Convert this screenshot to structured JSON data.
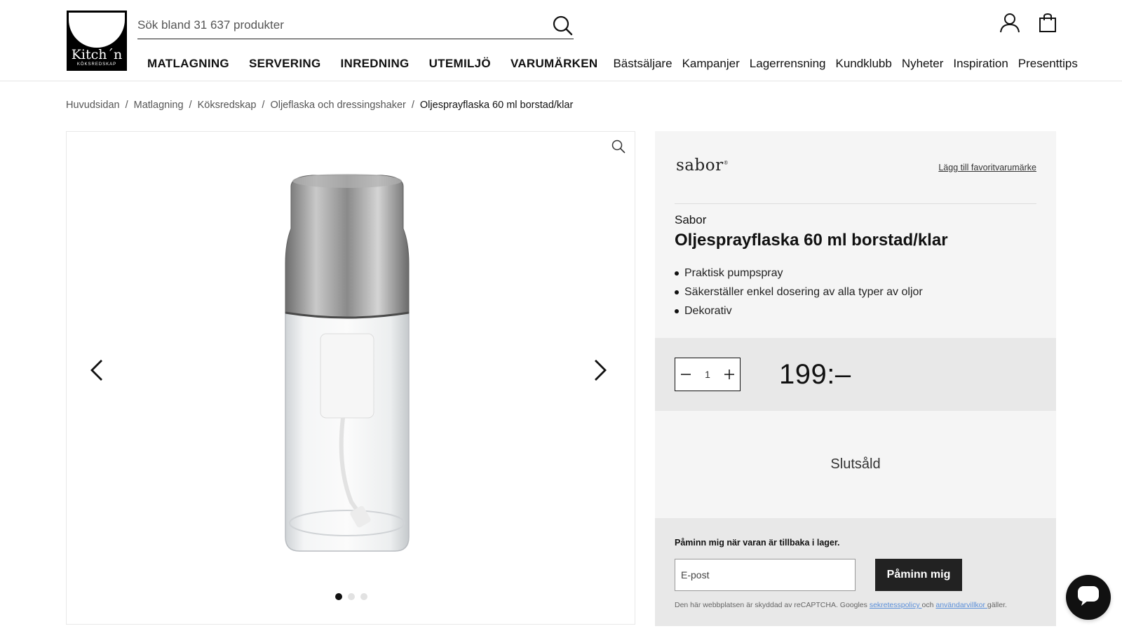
{
  "header": {
    "logo": {
      "name": "Kitch´n",
      "sub": "KÖKSREDSKAP"
    },
    "search": {
      "placeholder": "Sök bland 31 637 produkter",
      "icon": "search-icon"
    },
    "icons": {
      "account": "user-icon",
      "cart": "shopping-bag-icon"
    },
    "nav_main": [
      "MATLAGNING",
      "SERVERING",
      "INREDNING",
      "UTEMILJÖ",
      "VARUMÄRKEN"
    ],
    "nav_sub": [
      "Bästsäljare",
      "Kampanjer",
      "Lagerrensning",
      "Kundklubb",
      "Nyheter",
      "Inspiration",
      "Presenttips"
    ]
  },
  "breadcrumb": {
    "items": [
      "Huvudsidan",
      "Matlagning",
      "Köksredskap",
      "Oljeflaska och dressingshaker"
    ],
    "separator": "/",
    "current": "Oljesprayflaska 60 ml borstad/klar"
  },
  "gallery": {
    "zoom_icon": "magnifier-icon",
    "prev_icon": "chevron-left-icon",
    "next_icon": "chevron-right-icon",
    "image_count": 3,
    "active_index": 0
  },
  "product": {
    "brand_logo": "sabor",
    "brand_logo_mark": "®",
    "favorite_link": "Lägg till favoritvarumärke",
    "brand": "Sabor",
    "title": "Oljesprayflaska 60 ml borstad/klar",
    "features": [
      "Praktisk pumpspray",
      "Säkerställer enkel dosering av alla typer av oljor",
      "Dekorativ"
    ],
    "quantity": "1",
    "price": "199:–",
    "stock_status": "Slutsåld"
  },
  "notify": {
    "label": "Påminn mig när varan är tillbaka i lager.",
    "email_placeholder": "E-post",
    "button": "Påminn mig",
    "recaptcha_prefix": "Den här webbplatsen är skyddad av reCAPTCHA. Googles ",
    "privacy_link": "sekretesspolicy ",
    "recaptcha_and": "och ",
    "terms_link": "användarvillkor ",
    "recaptcha_suffix": "gäller."
  },
  "chat": {
    "icon": "chat-bubble-icon"
  },
  "colors": {
    "accent": "#222222",
    "panel": "#f5f5f5",
    "panel_dark": "#e8e8e8",
    "link": "#5b8fd9"
  }
}
